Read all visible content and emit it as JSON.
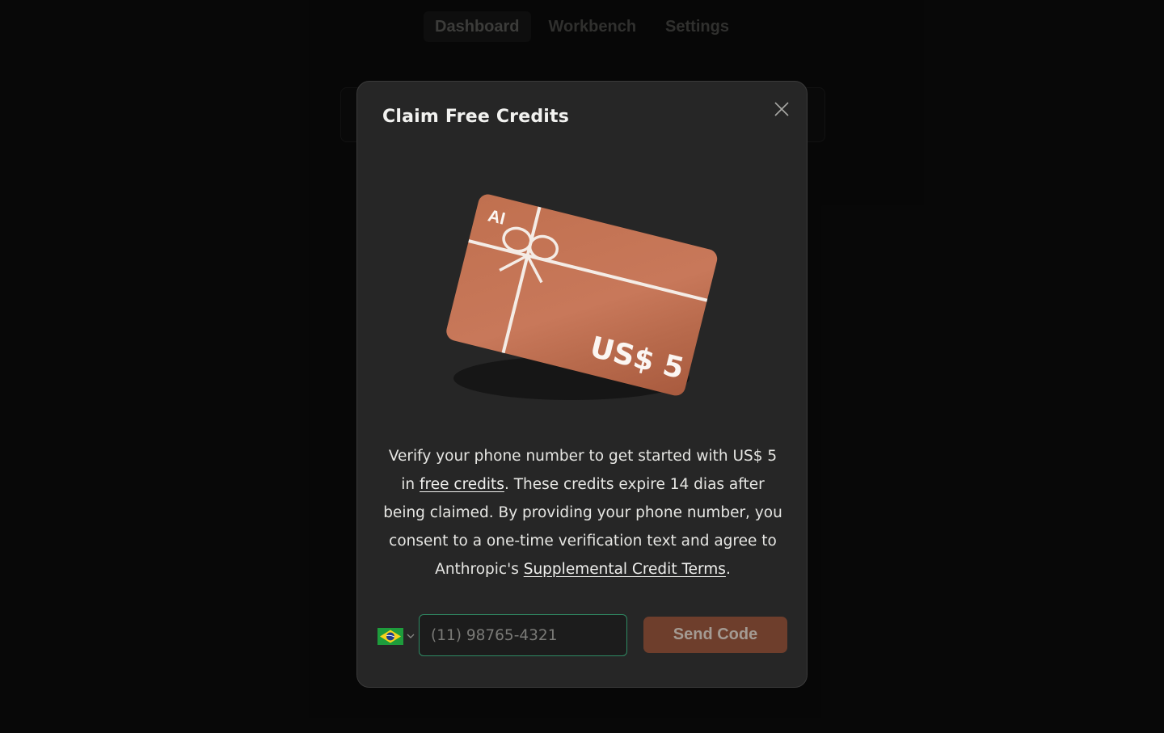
{
  "nav": {
    "tabs": [
      {
        "label": "Dashboard",
        "active": true
      },
      {
        "label": "Workbench",
        "active": false
      },
      {
        "label": "Settings",
        "active": false
      }
    ]
  },
  "modal": {
    "title": "Claim Free Credits",
    "close_icon": "close-icon",
    "card": {
      "logo": "AI",
      "amount": "US$ 5",
      "color": "#c0704f"
    },
    "description": {
      "part1": "Verify your phone number to get started with US$ 5 in ",
      "link1": "free credits",
      "part2": ". These credits expire 14 dias after being claimed. By providing your phone number, you consent to a one-time verification text and agree to Anthropic's ",
      "link2": "Supplemental Credit Terms",
      "part3": "."
    },
    "country": {
      "flag_icon": "brazil-flag-icon",
      "chevron_icon": "chevron-down-icon"
    },
    "phone": {
      "value": "",
      "placeholder": "(11) 98765-4321"
    },
    "send_button": "Send Code"
  },
  "colors": {
    "accent": "#6e3e2c",
    "input_border": "#2f8a63",
    "modal_bg": "#262626"
  }
}
